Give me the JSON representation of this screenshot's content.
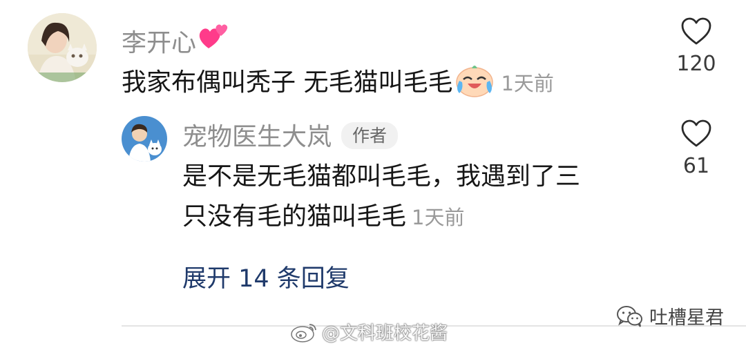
{
  "comments": [
    {
      "username": "李开心",
      "username_emoji": "💕",
      "text": "我家布偶叫秃子 无毛猫叫毛毛",
      "text_emoji": "😭",
      "time": "1天前",
      "likes": "120"
    },
    {
      "username": "宠物医生大岚",
      "badge": "作者",
      "text_line1": "是不是无毛猫都叫毛毛，我遇到了三",
      "text_line2": "只没有毛的猫叫毛毛",
      "time": "1天前",
      "likes": "61"
    }
  ],
  "expand_replies": "展开 14 条回复",
  "wechat_account": "吐槽星君",
  "watermark": "@文科班校花酱",
  "icons": {
    "like": "heart-outline-icon",
    "wechat": "wechat-icon",
    "weibo": "weibo-icon"
  },
  "colors": {
    "username": "#8e8e8e",
    "expand_link": "#1f3a6b",
    "heart_emoji": "#ff3b8a"
  }
}
